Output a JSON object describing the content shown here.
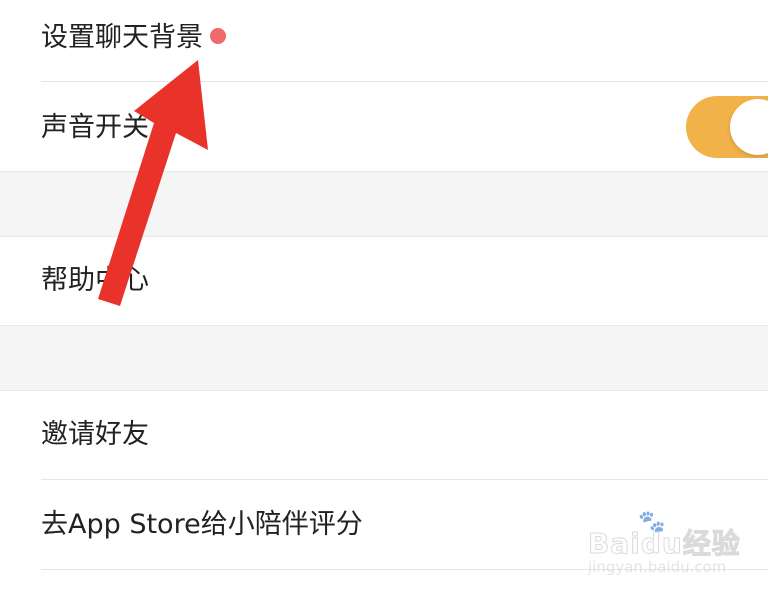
{
  "settings": {
    "items": [
      {
        "label": "设置聊天背景"
      },
      {
        "label": "声音开关"
      },
      {
        "label": "帮助中心"
      },
      {
        "label": "邀请好友"
      },
      {
        "label": "去App Store给小陪伴评分"
      }
    ]
  },
  "toggle": {
    "state": "on",
    "color": "#f1b24a"
  },
  "badge": {
    "color": "#ef6a6a"
  },
  "annotation": {
    "arrow_color": "#e8322a"
  },
  "watermark": {
    "brand": "Baidu经验",
    "url": "jingyan.baidu.com"
  }
}
